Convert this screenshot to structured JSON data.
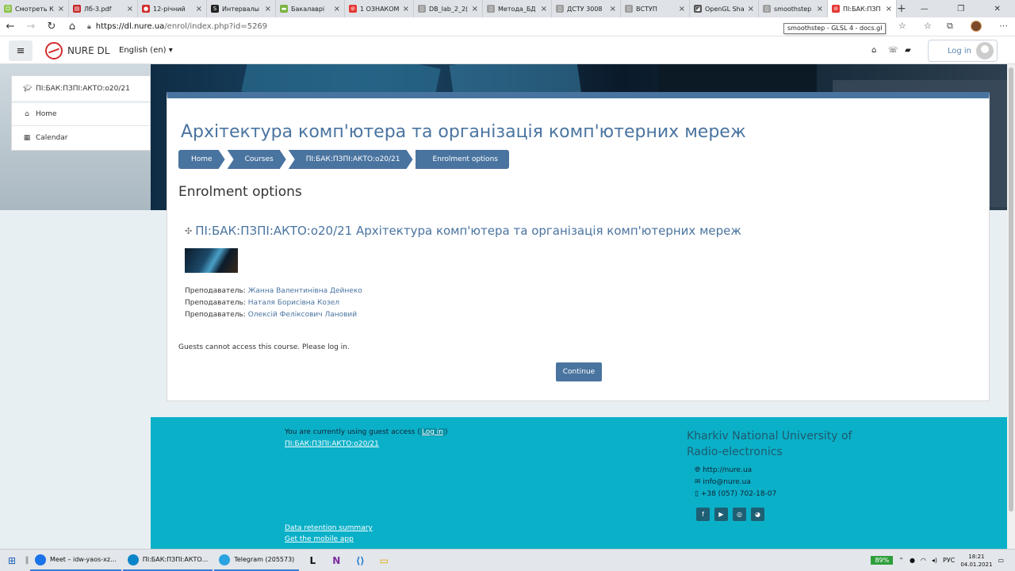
{
  "browser": {
    "tabs": [
      {
        "label": "Смотреть К",
        "color": "#8bc34a",
        "glyph": "☺"
      },
      {
        "label": "Лб-3.pdf",
        "color": "#c62828",
        "glyph": "▤"
      },
      {
        "label": "12-річний",
        "color": "#d32f2f",
        "glyph": "●"
      },
      {
        "label": "Интервалы",
        "color": "#222222",
        "glyph": "S"
      },
      {
        "label": "Бакалаврi",
        "color": "#7cb342",
        "glyph": "▬"
      },
      {
        "label": "1 ОЗНАКОМ",
        "color": "#e53935",
        "glyph": "⊘"
      },
      {
        "label": "DB_lab_2_2(",
        "color": "#9e9e9e",
        "glyph": "▯"
      },
      {
        "label": "Метода_БД",
        "color": "#9e9e9e",
        "glyph": "▯"
      },
      {
        "label": "ДСТУ 3008",
        "color": "#9e9e9e",
        "glyph": "▯"
      },
      {
        "label": "ВСТУП",
        "color": "#9e9e9e",
        "glyph": "▯"
      },
      {
        "label": "OpenGL Sha",
        "color": "#555555",
        "glyph": "◪"
      },
      {
        "label": "smoothstep",
        "color": "#9e9e9e",
        "glyph": "▯"
      },
      {
        "label": "ПІ:БАК:ПЗП",
        "color": "#e53935",
        "glyph": "⊘",
        "active": true
      }
    ],
    "new_tab": "+",
    "url_host": "https://dl.nure.ua",
    "url_path": "/enrol/index.php?id=5269",
    "tooltip": "smoothstep - GLSL 4 - docs.gl"
  },
  "navbar": {
    "brand": "NURE DL",
    "language": "English (en) ▾",
    "login": "Log in"
  },
  "sidebar": {
    "course": "ПІ:БАК:ПЗПІ:АКТО:о20/21",
    "items": [
      "Home",
      "Calendar"
    ]
  },
  "main": {
    "course_title": "Архітектура комп'ютера та організація комп'ютерних мереж",
    "breadcrumb": [
      "Home",
      "Courses",
      "ПІ:БАК:ПЗПІ:АКТО:о20/21",
      "Enrolment options"
    ],
    "page_heading": "Enrolment options",
    "course_box_title": "ПІ:БАК:ПЗПІ:АКТО:о20/21 Архітектура комп'ютера та організація комп'ютерних мереж",
    "teacher_label": "Преподаватель:",
    "teachers": [
      "Жанна Валентинівна Дейнеко",
      "Наталя Борисівна Козел",
      "Олексій Феліксович Лановий"
    ],
    "guest_message": "Guests cannot access this course. Please log in.",
    "continue": "Continue"
  },
  "footer": {
    "guest_text": "You are currently using guest access (",
    "guest_login": "Log in",
    "guest_close": ")",
    "course_link": "ПІ:БАК:ПЗПІ:АКТО:о20/21",
    "data_retention": "Data retention summary",
    "mobile_app": "Get the mobile app",
    "university_line1": "Kharkiv National University of",
    "university_line2": "Radio-electronics",
    "website": "http://nure.ua",
    "email": "info@nure.ua",
    "phone": "+38 (057) 702-18-07",
    "social": [
      "f",
      "▶",
      "◎",
      "◕"
    ]
  },
  "taskbar": {
    "windows": [
      {
        "label": "Meet – idw-yaos-xz...",
        "color": "#1a73e8"
      },
      {
        "label": "ПІ:БАК:ПЗПІ:АКТО...",
        "color": "#0a84c8"
      },
      {
        "label": "Telegram (205573)",
        "color": "#2aa3e0"
      }
    ],
    "battery": "89%",
    "lang": "РУС",
    "time": "18:21",
    "date": "04.01.2021"
  }
}
